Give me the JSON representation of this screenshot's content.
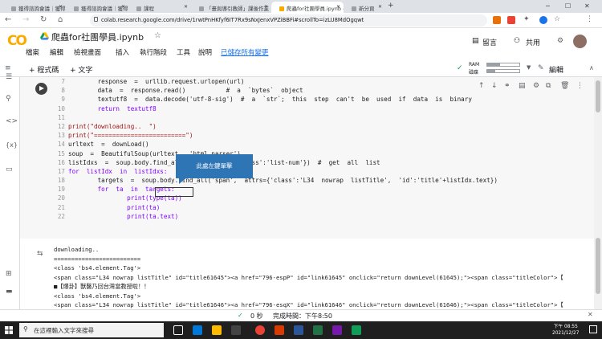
{
  "browser": {
    "tabs": [
      {
        "label": "獲得諮詢會議｜獲得諮詢會議",
        "active": false
      },
      {
        "label": "獲得諮詢會議｜獲得諮詢會議",
        "active": false
      },
      {
        "label": "課程",
        "active": false
      },
      {
        "label": "「畫與導引教師」課後作業",
        "active": false
      },
      {
        "label": "爬蟲for社團學員.ipynb - Colabor",
        "active": true
      },
      {
        "label": "新分頁",
        "active": false
      }
    ],
    "new_tab": "+",
    "url": "colab.research.google.com/drive/1rwtPnHKfyf6IT7Rx9sNxJenxVPZiBBFi#scrollTo=izLU8MdOgqwt"
  },
  "colab": {
    "logo": "CO",
    "title": "爬蟲for社團學員.ipynb",
    "menu": [
      "檔案",
      "編輯",
      "檢視畫面",
      "插入",
      "執行階段",
      "工具",
      "說明"
    ],
    "saved_status": "已儲存所有變更",
    "comment_label": "留言",
    "share_label": "共用",
    "add_code": "+ 程式碼",
    "add_text": "+ 文字",
    "ram_label": "RAM",
    "disk_label": "磁碟",
    "ram_level": 0.4,
    "disk_level": 0.25,
    "edit_label": "編輯"
  },
  "code_lines": [
    {
      "n": "7",
      "t": "        response  =  urllib.request.urlopen(url)"
    },
    {
      "n": "8",
      "t": "        data  =  response.read()           #  a  `bytes`  object"
    },
    {
      "n": "9",
      "t": "        textutf8  =  data.decode('utf-8-sig')  #  a  `str`;  this  step  can't  be  used  if  data  is  binary"
    },
    {
      "n": "10",
      "t": "        return  textutf8"
    },
    {
      "n": "11",
      "t": ""
    },
    {
      "n": "12",
      "t": "print(\"downloading..  \")"
    },
    {
      "n": "13",
      "t": "print(\"=========================\")"
    },
    {
      "n": "14",
      "t": "urltext  =  downLoad()"
    },
    {
      "n": "15",
      "t": "soup  =  BeautifulSoup(urltext,  'html.parser')"
    },
    {
      "n": "16",
      "t": "listIdxs  =  soup.body.find_all('ul',  attrs={'class':'list-num'})  #  get  all  list"
    },
    {
      "n": "17",
      "t": "for  listIdx  in  listIdxs:"
    },
    {
      "n": "18",
      "t": "        targets  =  soup.body.find_all('span',  attrs={'class':'L34  nowrap  listTitle',  'id':'title'+listIdx.text})"
    },
    {
      "n": "19",
      "t": "        for  ta  in  targets:"
    },
    {
      "n": "20",
      "t": "                print(type(ta))"
    },
    {
      "n": "21",
      "t": "                print(ta)"
    },
    {
      "n": "22",
      "t": "                print(ta.text)"
    }
  ],
  "callout": "此處左鍵單擊",
  "output_lines": [
    "downloading..",
    "=========================",
    "<class 'bs4.element.Tag'>",
    "<span class=\"L34 nowrap listTitle\" id=\"title61645\"><a href=\"796-espP\" id=\"link61645\" onclick=\"return downLevel(61645);\"><span class=\"titleColor\">【",
    "■【爆卦】獸醫乃回台灣當教授啦！！",
    "<class 'bs4.element.Tag'>",
    "<span class=\"L34 nowrap listTitle\" id=\"title61646\"><a href=\"796-esqX\" id=\"link61646\" onclick=\"return downLevel(61646);\"><span class=\"titleColor\">【"
  ],
  "status": {
    "check": "✓",
    "seconds": "0 秒",
    "completed": "完成時間：下午8:50"
  },
  "taskbar": {
    "search_placeholder": "在這裡輸入文字來搜尋",
    "time": "下午 08:55",
    "date": "2021/12/27"
  }
}
